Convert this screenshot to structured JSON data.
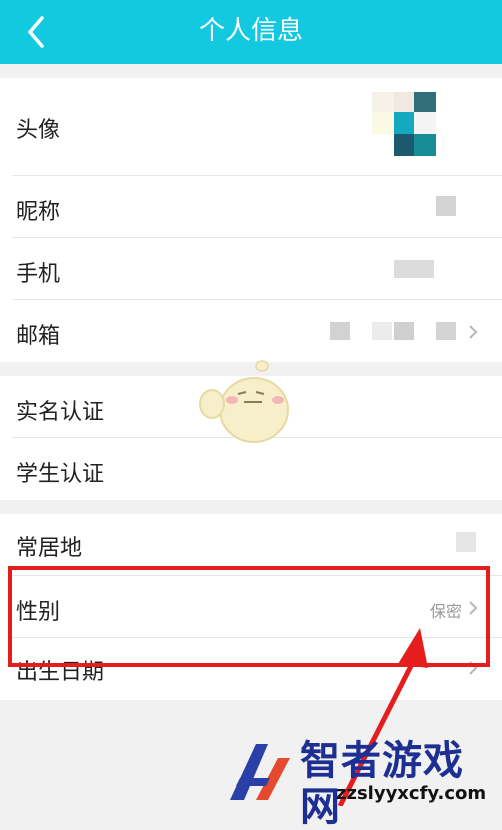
{
  "header": {
    "title": "个人信息",
    "back_icon": "chevron-left-icon"
  },
  "profile": {
    "rows": [
      {
        "label": "头像"
      },
      {
        "label": "昵称"
      },
      {
        "label": "手机"
      },
      {
        "label": "邮箱"
      }
    ]
  },
  "verification": {
    "rows": [
      {
        "label": "实名认证"
      },
      {
        "label": "学生认证"
      }
    ]
  },
  "details": {
    "rows": [
      {
        "label": "常居地"
      },
      {
        "label": "性别",
        "value": "保密"
      },
      {
        "label": "出生日期"
      }
    ]
  },
  "watermark": {
    "title": "智者游戏网",
    "url": "zzslyyxcfy.com"
  },
  "colors": {
    "header": "#12c9e0",
    "highlight": "#e51d1d",
    "brand": "#1d2f93"
  }
}
